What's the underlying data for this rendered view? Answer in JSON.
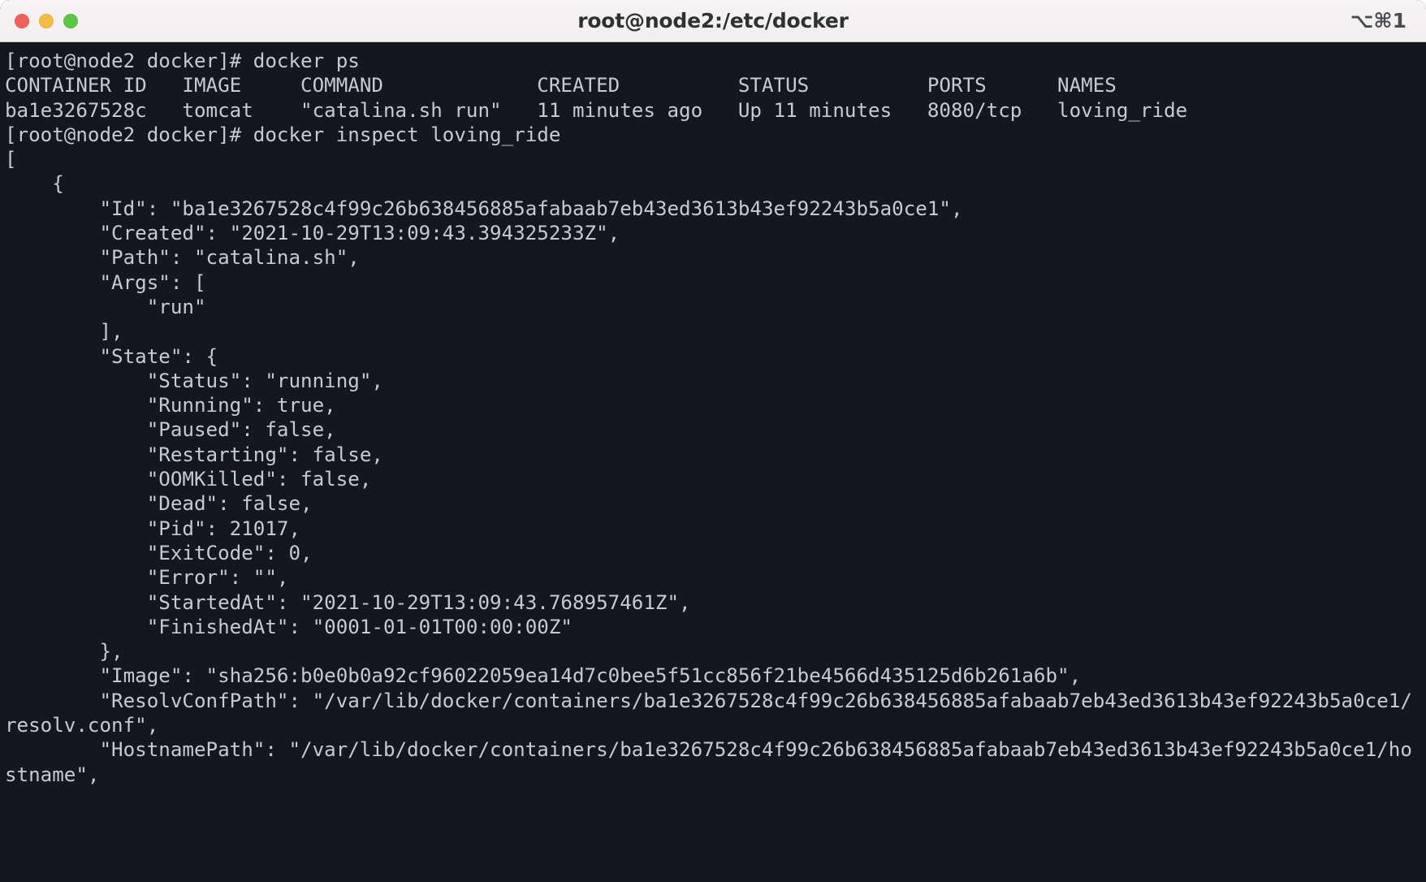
{
  "window": {
    "title": "root@node2:/etc/docker",
    "shortcut": "⌥⌘1",
    "traffic_lights": {
      "close": "close",
      "minimize": "minimize",
      "zoom": "zoom"
    },
    "colors": {
      "titlebar_bg": "#f4f1f2",
      "terminal_bg": "#14171b",
      "terminal_fg": "#c3cbd4",
      "light_close": "#f0615b",
      "light_min": "#f2bc45",
      "light_zoom": "#5cc648"
    }
  },
  "terminal": {
    "lines": [
      "[root@node2 docker]# docker ps",
      "CONTAINER ID   IMAGE     COMMAND             CREATED          STATUS          PORTS      NAMES",
      "ba1e3267528c   tomcat    \"catalina.sh run\"   11 minutes ago   Up 11 minutes   8080/tcp   loving_ride",
      "[root@node2 docker]# docker inspect loving_ride",
      "[",
      "    {",
      "        \"Id\": \"ba1e3267528c4f99c26b638456885afabaab7eb43ed3613b43ef92243b5a0ce1\",",
      "        \"Created\": \"2021-10-29T13:09:43.394325233Z\",",
      "        \"Path\": \"catalina.sh\",",
      "        \"Args\": [",
      "            \"run\"",
      "        ],",
      "        \"State\": {",
      "            \"Status\": \"running\",",
      "            \"Running\": true,",
      "            \"Paused\": false,",
      "            \"Restarting\": false,",
      "            \"OOMKilled\": false,",
      "            \"Dead\": false,",
      "            \"Pid\": 21017,",
      "            \"ExitCode\": 0,",
      "            \"Error\": \"\",",
      "            \"StartedAt\": \"2021-10-29T13:09:43.768957461Z\",",
      "            \"FinishedAt\": \"0001-01-01T00:00:00Z\"",
      "        },",
      "        \"Image\": \"sha256:b0e0b0a92cf96022059ea14d7c0bee5f51cc856f21be4566d435125d6b261a6b\",",
      "        \"ResolvConfPath\": \"/var/lib/docker/containers/ba1e3267528c4f99c26b638456885afabaab7eb43ed3613b43ef92243b5a0ce1/resolv.conf\",",
      "        \"HostnamePath\": \"/var/lib/docker/containers/ba1e3267528c4f99c26b638456885afabaab7eb43ed3613b43ef92243b5a0ce1/hostname\","
    ]
  }
}
